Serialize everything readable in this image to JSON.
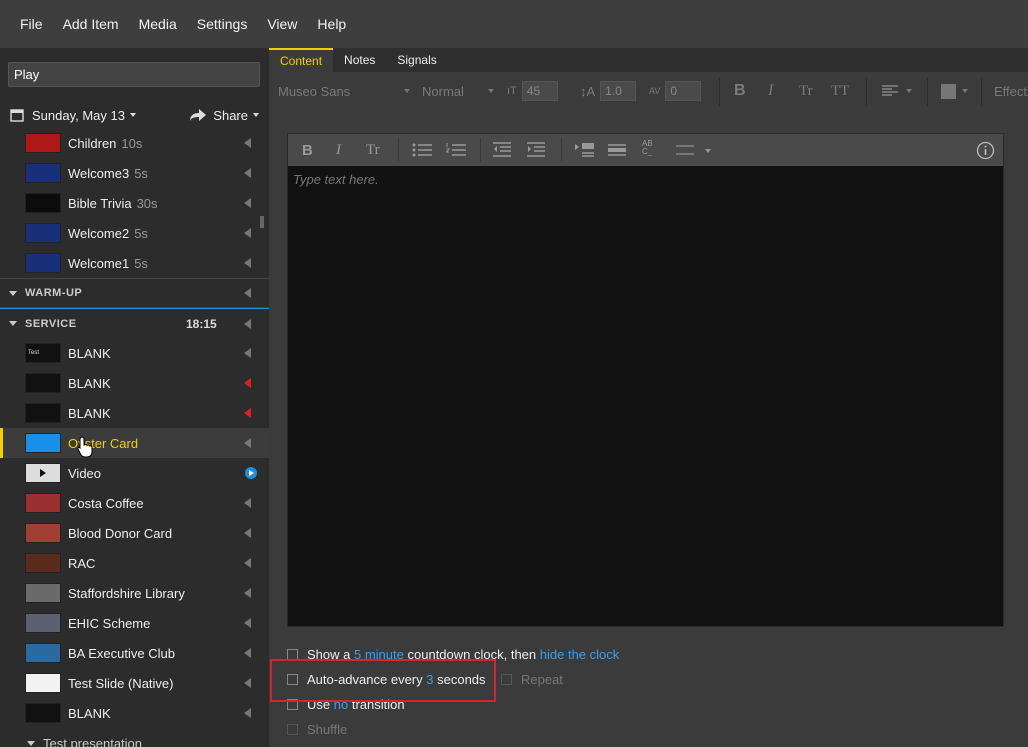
{
  "menubar": {
    "items": [
      "File",
      "Add Item",
      "Media",
      "Settings",
      "View",
      "Help"
    ]
  },
  "sidebar": {
    "search_value": "Play",
    "date_label": "Sunday, May 13",
    "share_label": "Share",
    "items": [
      {
        "label": "Children",
        "duration": "10s",
        "thumb": "red"
      },
      {
        "label": "Welcome3",
        "duration": "5s",
        "thumb": "blue"
      },
      {
        "label": "Bible Trivia",
        "duration": "30s",
        "thumb": "black"
      },
      {
        "label": "Welcome2",
        "duration": "5s",
        "thumb": "blue"
      },
      {
        "label": "Welcome1",
        "duration": "5s",
        "thumb": "blue"
      }
    ],
    "sections": {
      "warmup": "WARM-UP",
      "service": "SERVICE",
      "service_time": "18:15",
      "test_presentation": "Test presentation"
    },
    "service_items": [
      {
        "label": "BLANK",
        "thumb_text": "Test",
        "arrow": "gray"
      },
      {
        "label": "BLANK",
        "arrow": "red"
      },
      {
        "label": "BLANK",
        "arrow": "red"
      },
      {
        "label": "Oyster Card",
        "arrow": "gray",
        "selected": true
      },
      {
        "label": "Video",
        "arrow": "play"
      },
      {
        "label": "Costa Coffee",
        "arrow": "gray"
      },
      {
        "label": "Blood Donor Card",
        "arrow": "gray"
      },
      {
        "label": "RAC",
        "arrow": "gray"
      },
      {
        "label": "Staffordshire Library",
        "arrow": "gray"
      },
      {
        "label": "EHIC Scheme",
        "arrow": "gray"
      },
      {
        "label": "BA Executive Club",
        "arrow": "gray"
      },
      {
        "label": "Test Slide (Native)",
        "arrow": "gray"
      },
      {
        "label": "BLANK",
        "arrow": "gray"
      }
    ]
  },
  "tabs": [
    "Content",
    "Notes",
    "Signals"
  ],
  "format": {
    "font": "Museo Sans",
    "weight": "Normal",
    "size": "45",
    "line_height": "1.0",
    "spacing": "0",
    "effects": "Effects"
  },
  "editor": {
    "placeholder": "Type text here."
  },
  "options": {
    "countdown": {
      "pre": "Show a",
      "link1": "5 minute",
      "mid": "countdown clock, then",
      "link2": "hide the clock"
    },
    "autoadvance": {
      "pre": "Auto-advance every",
      "link": "3",
      "post": "seconds"
    },
    "repeat": "Repeat",
    "transition": {
      "pre": "Use",
      "link": "no",
      "post": "transition"
    },
    "shuffle": "Shuffle"
  },
  "colors": {
    "accent": "#f0d000",
    "link": "#3a9ef0",
    "highlight": "#d8232a"
  }
}
